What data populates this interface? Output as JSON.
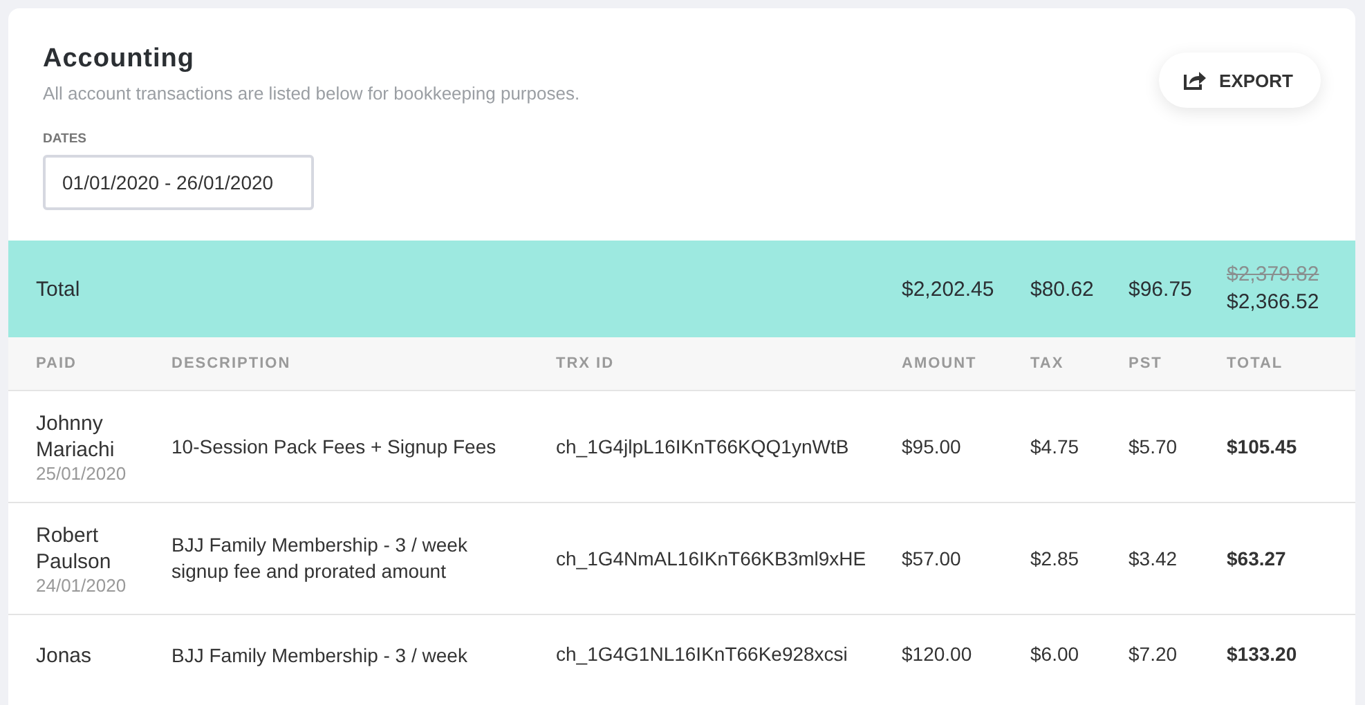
{
  "header": {
    "title": "Accounting",
    "subtitle": "All account transactions are listed below for bookkeeping purposes.",
    "export_button": "EXPORT"
  },
  "dates": {
    "label": "DATES",
    "value": "01/01/2020 - 26/01/2020"
  },
  "totals": {
    "label": "Total",
    "amount": "$2,202.45",
    "tax": "$80.62",
    "pst": "$96.75",
    "original_total": "$2,379.82",
    "total": "$2,366.52"
  },
  "table": {
    "columns": [
      "PAID",
      "DESCRIPTION",
      "TRX ID",
      "AMOUNT",
      "TAX",
      "PST",
      "TOTAL"
    ],
    "rows": [
      {
        "name": "Johnny Mariachi",
        "date": "25/01/2020",
        "description": "10-Session Pack Fees + Signup Fees",
        "trx_id": "ch_1G4jlpL16IKnT66KQQ1ynWtB",
        "amount": "$95.00",
        "tax": "$4.75",
        "pst": "$5.70",
        "total": "$105.45"
      },
      {
        "name": "Robert Paulson",
        "date": "24/01/2020",
        "description": "BJJ Family Membership - 3 / week signup fee and prorated amount",
        "trx_id": "ch_1G4NmAL16IKnT66KB3ml9xHE",
        "amount": "$57.00",
        "tax": "$2.85",
        "pst": "$3.42",
        "total": "$63.27"
      },
      {
        "name": "Jonas",
        "description": "BJJ Family Membership - 3 / week",
        "trx_id": "ch_1G4G1NL16IKnT66Ke928xcsi",
        "amount": "$120.00",
        "tax": "$6.00",
        "pst": "$7.20",
        "total": "$133.20"
      }
    ]
  }
}
